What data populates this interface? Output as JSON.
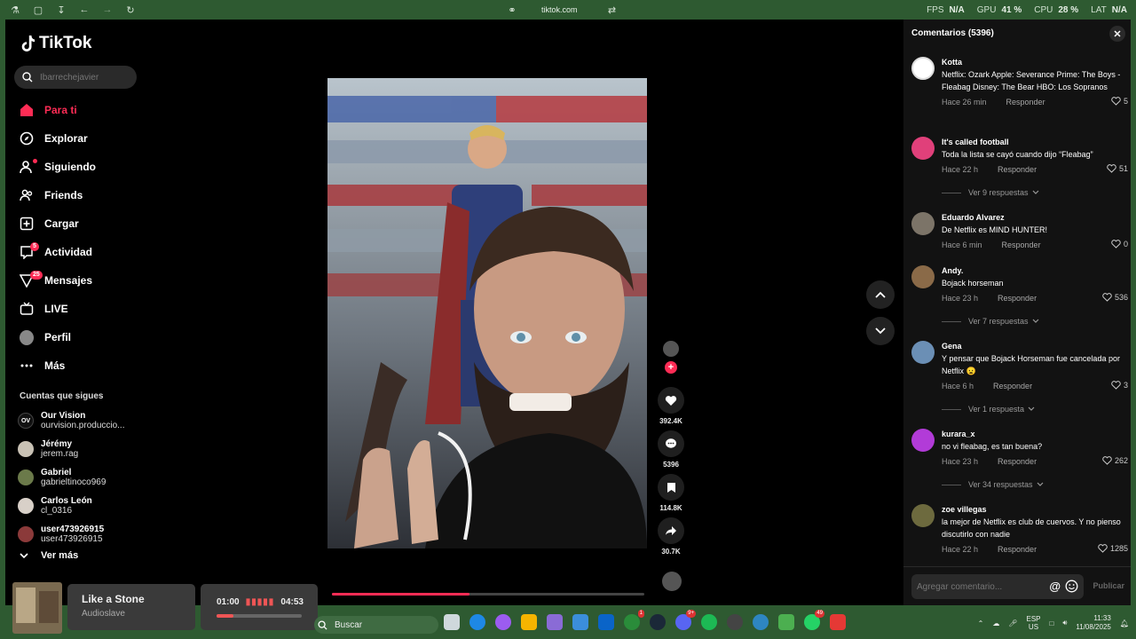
{
  "browser": {
    "url": "tiktok.com",
    "perf": {
      "fps_label": "FPS",
      "fps": "N/A",
      "gpu_label": "GPU",
      "gpu": "41 %",
      "cpu_label": "CPU",
      "cpu": "28 %",
      "lat_label": "LAT",
      "lat": "N/A"
    }
  },
  "sidebar": {
    "logo": "TikTok",
    "search_placeholder": "Ibarrechejavier",
    "nav": [
      {
        "label": "Para ti",
        "icon": "home-icon",
        "active": true
      },
      {
        "label": "Explorar",
        "icon": "compass-icon"
      },
      {
        "label": "Siguiendo",
        "icon": "following-icon"
      },
      {
        "label": "Friends",
        "icon": "friends-icon"
      },
      {
        "label": "Cargar",
        "icon": "upload-icon"
      },
      {
        "label": "Actividad",
        "icon": "activity-icon",
        "badge": "5"
      },
      {
        "label": "Mensajes",
        "icon": "messages-icon",
        "badge": "25"
      },
      {
        "label": "LIVE",
        "icon": "live-icon"
      },
      {
        "label": "Perfil",
        "icon": "profile-icon"
      },
      {
        "label": "Más",
        "icon": "more-icon"
      }
    ],
    "following_title": "Cuentas que sigues",
    "following": [
      {
        "name": "Our Vision",
        "handle": "ourvision.produccio..."
      },
      {
        "name": "Jérémy",
        "handle": "jerem.rag"
      },
      {
        "name": "Gabriel",
        "handle": "gabrieltinoco969"
      },
      {
        "name": "Carlos León",
        "handle": "cl_0316"
      },
      {
        "name": "user473926915",
        "handle": "user473926915"
      }
    ],
    "see_more": "Ver más"
  },
  "video": {
    "progress": 0.44,
    "actions": {
      "likes": "392.4K",
      "comments": "5396",
      "saves": "114.8K",
      "shares": "30.7K"
    }
  },
  "comments": {
    "header": "Comentarios (5396)",
    "reply_label": "Responder",
    "items": [
      {
        "user": "Kotta",
        "text": "Netflix: Ozark Apple: Severance Prime: The Boys - Fleabag Disney: The Bear HBO: Los Sopranos",
        "time": "Hace 26 min",
        "likes": "5",
        "replies": ""
      },
      {
        "user": "It's called football",
        "text": "Toda la lista se cayó cuando dijo “Fleabag”",
        "time": "Hace 22 h",
        "likes": "51",
        "replies": "Ver 9 respuestas"
      },
      {
        "user": "Eduardo Alvarez",
        "text": "De Netflix es MIND HUNTER!",
        "time": "Hace 6 min",
        "likes": "0",
        "replies": ""
      },
      {
        "user": "Andy.",
        "text": "Bojack horseman",
        "time": "Hace 23 h",
        "likes": "536",
        "replies": "Ver 7 respuestas"
      },
      {
        "user": "Gena",
        "text": "Y pensar que Bojack Horseman fue cancelada por Netflix 😦",
        "time": "Hace 6 h",
        "likes": "3",
        "replies": "Ver 1 respuesta"
      },
      {
        "user": "kurara_x",
        "text": "no vi fleabag, es tan buena?",
        "time": "Hace 23 h",
        "likes": "262",
        "replies": "Ver 34 respuestas"
      },
      {
        "user": "zoe villegas",
        "text": "la mejor de Netflix es club de cuervos. Y no pienso discutirlo con nadie",
        "time": "Hace 22 h",
        "likes": "1285",
        "replies": ""
      }
    ],
    "input_placeholder": "Agregar comentario...",
    "post_label": "Publicar"
  },
  "taskbar": {
    "media": {
      "title": "Like a Stone",
      "artist": "Audioslave",
      "current": "01:00",
      "total": "04:53",
      "progress": 0.2
    },
    "search_label": "Buscar",
    "lang": "ESP",
    "region": "US",
    "time": "11:33",
    "date": "11/08/2025",
    "badges": {
      "xbox": "1",
      "discord": "9+",
      "whatsapp": "49"
    }
  },
  "colors": {
    "accent": "#fe2c55",
    "taskbar": "#2e5a31",
    "panel": "#121212"
  }
}
